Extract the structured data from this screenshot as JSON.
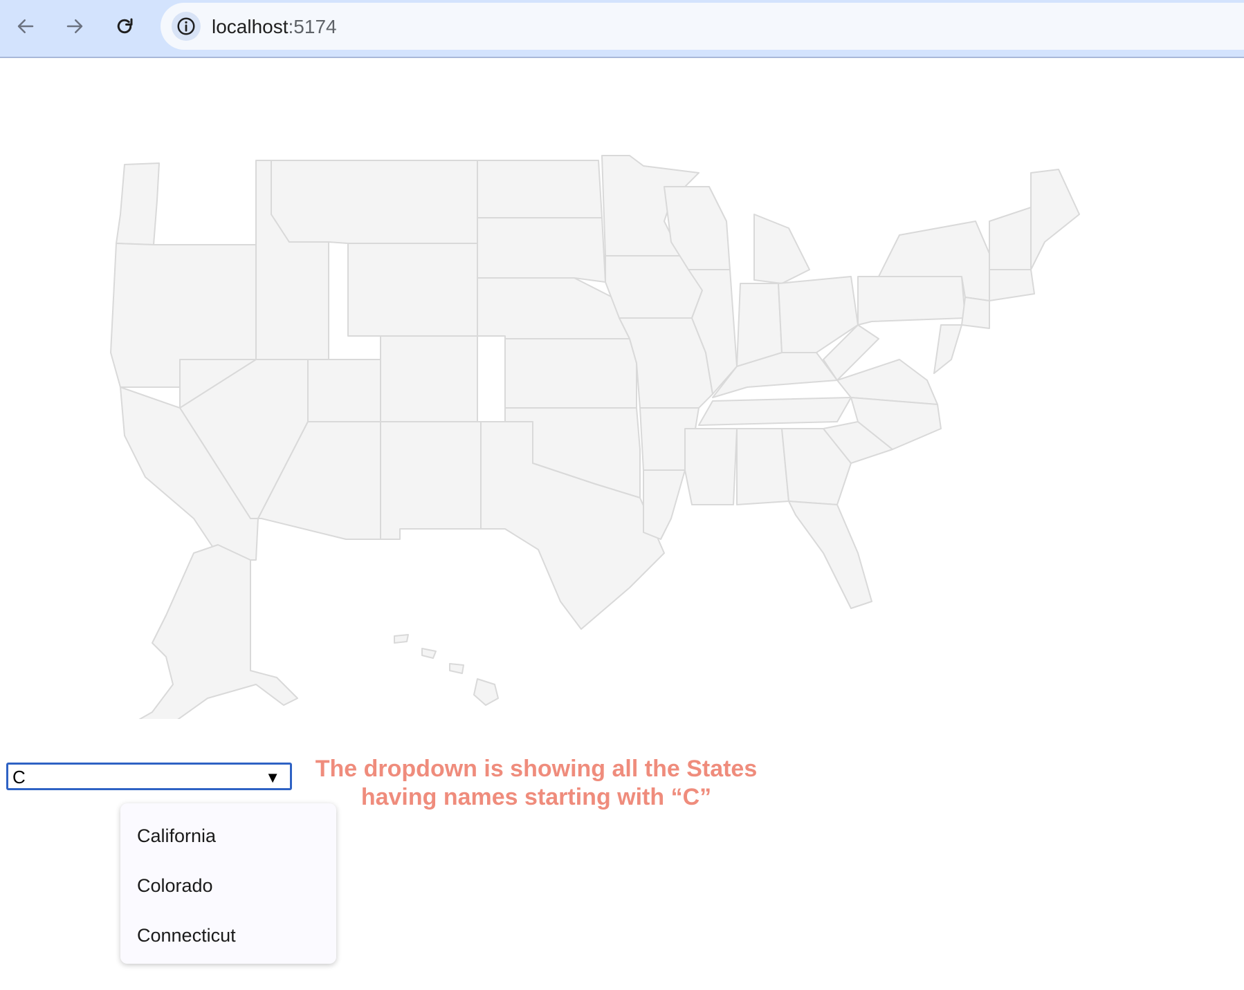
{
  "browser": {
    "url_host": "localhost",
    "url_port": ":5174",
    "icons": [
      "back-arrow-icon",
      "forward-arrow-icon",
      "reload-icon",
      "site-info-icon"
    ]
  },
  "map": {
    "fill_color": "#f4f4f4",
    "border_color": "#d9d9d9"
  },
  "dropdown": {
    "value": "C",
    "arrow": "▼",
    "border_color": "#2e62c4",
    "options": [
      "California",
      "Colorado",
      "Connecticut"
    ]
  },
  "annotation": {
    "line1": "The dropdown is showing all the States",
    "line2": "having names starting with “C”",
    "color": "#ef8c7c"
  }
}
